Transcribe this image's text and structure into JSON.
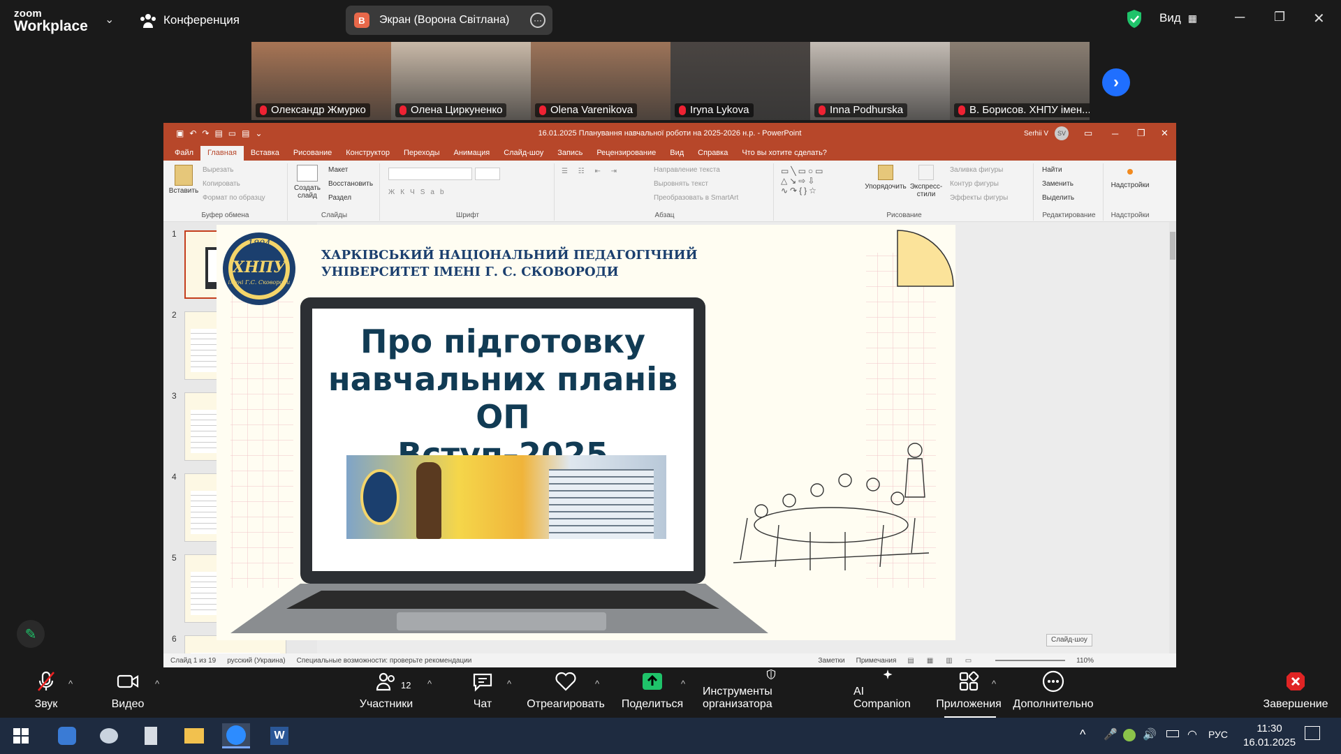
{
  "zoom": {
    "brand_top": "zoom",
    "brand_bottom": "Workplace",
    "meeting_label": "Конференция",
    "share_initial": "В",
    "share_title": "Экран (Ворона Світлана)",
    "view_label": "Вид"
  },
  "participants": [
    {
      "name": "Олександр Жмурко",
      "bg": "#a87555"
    },
    {
      "name": "Олена Циркуненко",
      "bg": "#c9b9a8"
    },
    {
      "name": "Olena Varenikova",
      "bg": "#9d7459"
    },
    {
      "name": "Iryna Lykova",
      "bg": "#4a4542"
    },
    {
      "name": "Inna Podhurska",
      "bg": "#c4bcb4"
    },
    {
      "name": "В. Борисов. ХНПУ імен...",
      "bg": "#8a7e72",
      "active": true
    }
  ],
  "ppt": {
    "title": "16.01.2025 Планування навчальної роботи на 2025-2026 н.р.  -  PowerPoint",
    "user": "Serhii V",
    "user_initials": "SV",
    "tabs": [
      "Файл",
      "Главная",
      "Вставка",
      "Рисование",
      "Конструктор",
      "Переходы",
      "Анимация",
      "Слайд-шоу",
      "Запись",
      "Рецензирование",
      "Вид",
      "Справка",
      "Что вы хотите сделать?"
    ],
    "active_tab": "Главная",
    "ribbon": {
      "paste": "Вставить",
      "cut": "Вырезать",
      "copy": "Копировать",
      "format_painter": "Формат по образцу",
      "clipboard": "Буфер обмена",
      "new_slide": "Создать слайд",
      "layout": "Макет",
      "reset": "Восстановить",
      "section": "Раздел",
      "slides": "Слайды",
      "font": "Шрифт",
      "text_direction": "Направление текста",
      "align_text": "Выровнять текст",
      "smartart": "Преобразовать в SmartArt",
      "paragraph": "Абзац",
      "arrange": "Упорядочить",
      "quick_styles": "Экспресс-стили",
      "shape_fill": "Заливка фигуры",
      "shape_outline": "Контур фигуры",
      "shape_effects": "Эффекты фигуры",
      "drawing": "Рисование",
      "find": "Найти",
      "replace": "Заменить",
      "select": "Выделить",
      "editing": "Редактирование",
      "addins": "Надстройки",
      "addins_group": "Надстройки"
    },
    "slide_numbers": [
      "1",
      "2",
      "3",
      "4",
      "5",
      "6"
    ],
    "slide": {
      "year": "1804",
      "logo_text": "ХНПУ",
      "logo_sub": "імені Г.С. Сковороди",
      "uni_line1": "ХАРКІВСЬКИЙ НАЦІОНАЛЬНИЙ ПЕДАГОГІЧНИЙ",
      "uni_line2": "УНІВЕРСИТЕТ ІМЕНІ Г. С. СКОВОРОДИ",
      "title_line1": "Про підготовку",
      "title_line2": "навчальних планів ОП",
      "title_line3": "Вступ–2025"
    },
    "tooltip": "Слайд-шоу",
    "status": {
      "slide": "Слайд 1 из 19",
      "lang": "русский (Украина)",
      "access": "Специальные возможности: проверьте рекомендации",
      "notes": "Заметки",
      "comments": "Примечания",
      "zoom": "110%"
    }
  },
  "toolbar": {
    "audio": "Звук",
    "video": "Видео",
    "participants": "Участники",
    "participants_count": "12",
    "chat": "Чат",
    "react": "Отреагировать",
    "share": "Поделиться",
    "host_tools": "Инструменты организатора",
    "ai": "AI Companion",
    "apps": "Приложения",
    "more": "Дополнительно",
    "end": "Завершение"
  },
  "taskbar": {
    "lang": "РУС",
    "time": "11:30",
    "date": "16.01.2025"
  }
}
